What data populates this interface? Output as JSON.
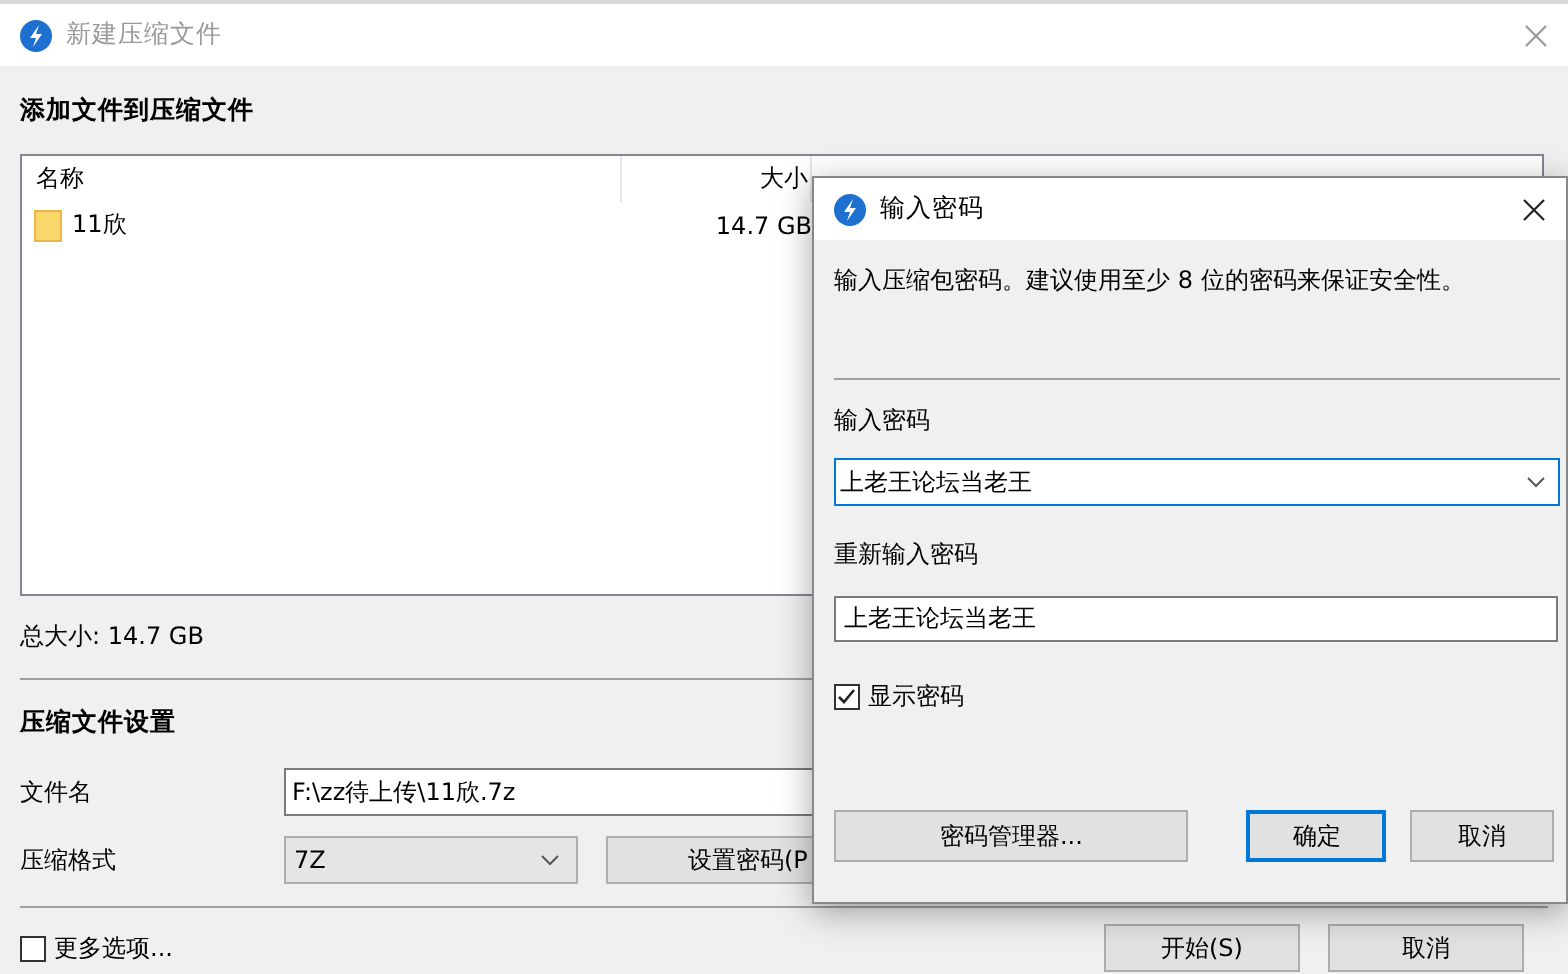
{
  "main_window": {
    "title": "新建压缩文件",
    "add_section_title": "添加文件到压缩文件",
    "file_list": {
      "columns": [
        "名称",
        "大小"
      ],
      "rows": [
        {
          "name": "11欣",
          "size": "14.7 GB"
        }
      ]
    },
    "total_size": "总大小: 14.7 GB",
    "settings_title": "压缩文件设置",
    "filename": {
      "label": "文件名",
      "value": "F:\\zz待上传\\11欣.7z"
    },
    "format": {
      "label": "压缩格式",
      "value": "7Z"
    },
    "set_password_button": "设置密码(P",
    "more_options": {
      "label": "更多选项...",
      "checked": false
    },
    "buttons": [
      {
        "label": "开始(S)",
        "default": false
      },
      {
        "label": "取消",
        "default": false
      }
    ]
  },
  "password_dialog": {
    "title": "输入密码",
    "description": "输入压缩包密码。建议使用至少 8 位的密码来保证安全性。",
    "password": {
      "label": "输入密码",
      "value": "上老王论坛当老王",
      "focused": true
    },
    "confirm": {
      "label": "重新输入密码",
      "value": "上老王论坛当老王",
      "focused": false
    },
    "show_password": {
      "label": "显示密码",
      "checked": true
    },
    "buttons": [
      {
        "label": "密码管理器...",
        "default": false
      },
      {
        "label": "确定",
        "default": true
      },
      {
        "label": "取消",
        "default": false
      }
    ]
  }
}
